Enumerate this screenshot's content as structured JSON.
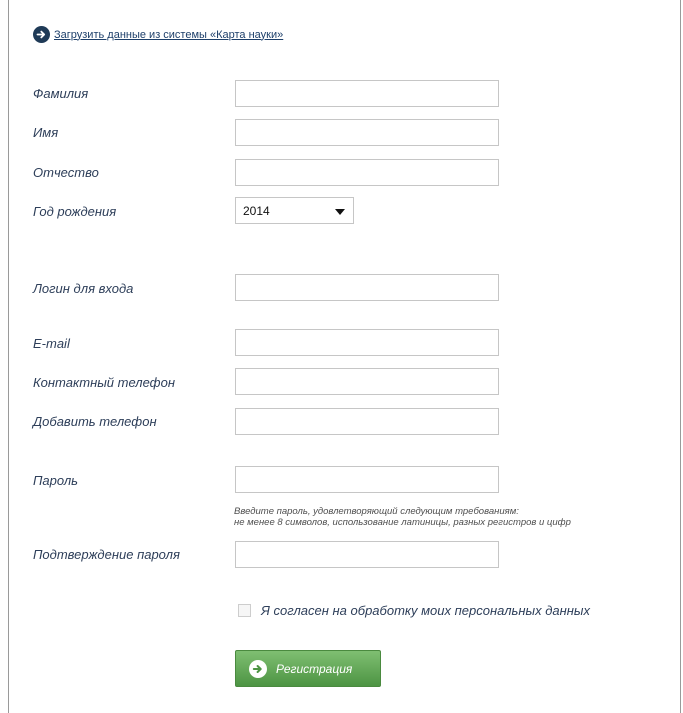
{
  "load_link": {
    "label": "Загрузить данные из системы «Карта науки»",
    "icon": "arrow-circle-icon"
  },
  "fields": {
    "last_name": {
      "label": "Фамилия",
      "value": "",
      "placeholder": ""
    },
    "first_name": {
      "label": "Имя",
      "value": "",
      "placeholder": ""
    },
    "patronymic": {
      "label": "Отчество",
      "value": "",
      "placeholder": ""
    },
    "birth_year": {
      "label": "Год рождения",
      "value": "2014"
    },
    "login": {
      "label": "Логин для входа",
      "value": "",
      "placeholder": ""
    },
    "email": {
      "label": "E-mail",
      "value": "",
      "placeholder": ""
    },
    "phone": {
      "label": "Контактный телефон",
      "value": "",
      "placeholder": ""
    },
    "add_phone": {
      "label": "Добавить телефон",
      "value": "",
      "placeholder": ""
    },
    "password": {
      "label": "Пароль",
      "value": "",
      "placeholder": "",
      "hint_line1": "Введите пароль, удовлетворяющий следующим требованиям:",
      "hint_line2": "не менее 8 символов, использование латиницы, разных регистров и цифр"
    },
    "password_confirm": {
      "label": "Подтверждение пароля",
      "value": "",
      "placeholder": ""
    }
  },
  "consent": {
    "label": "Я согласен на обработку моих персональных данных",
    "checked": false
  },
  "register_button": {
    "label": "Регистрация",
    "icon": "arrow-circle-icon"
  },
  "colors": {
    "label_text": "#2d3e59",
    "link_text": "#1d3f6a",
    "button_green": "#5fa554",
    "icon_dark": "#1f3a57"
  }
}
